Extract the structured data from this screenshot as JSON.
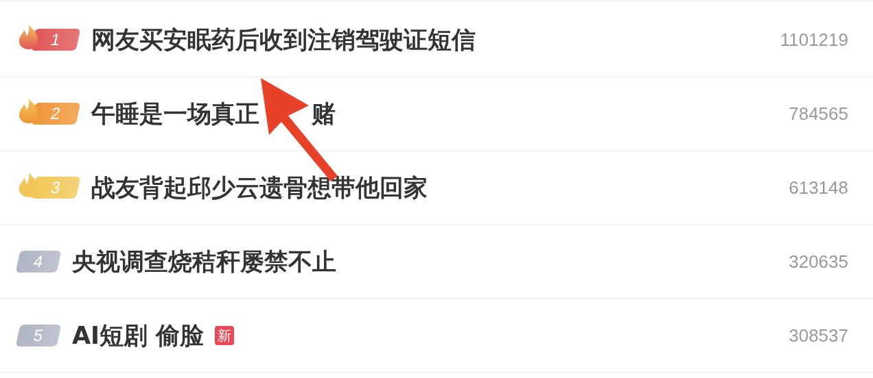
{
  "rows": [
    {
      "rank": "1",
      "kind": "flame",
      "color": "#e05555",
      "title_segments": [
        "网友买安眠药后收到注销驾驶证短信"
      ],
      "count": "1101219"
    },
    {
      "rank": "2",
      "kind": "flame",
      "color": "#ee9636",
      "title_segments": [
        "午睡是一场真正",
        "赌"
      ],
      "count": "784565"
    },
    {
      "rank": "3",
      "kind": "flame",
      "color": "#f1c756",
      "title_segments": [
        "战友背起邱少云遗骨想带他回家"
      ],
      "count": "613148"
    },
    {
      "rank": "4",
      "kind": "plain",
      "color": "#b0b5c4",
      "title_segments": [
        "央视调查烧秸秆屡禁不止"
      ],
      "count": "320635"
    },
    {
      "rank": "5",
      "kind": "plain",
      "color": "#b0b5c4",
      "title_segments": [
        "AI短剧 偷脸"
      ],
      "tag": "新",
      "count": "308537"
    }
  ],
  "annotations": [
    {
      "kind": "arrow",
      "color": "#e8412a"
    }
  ]
}
